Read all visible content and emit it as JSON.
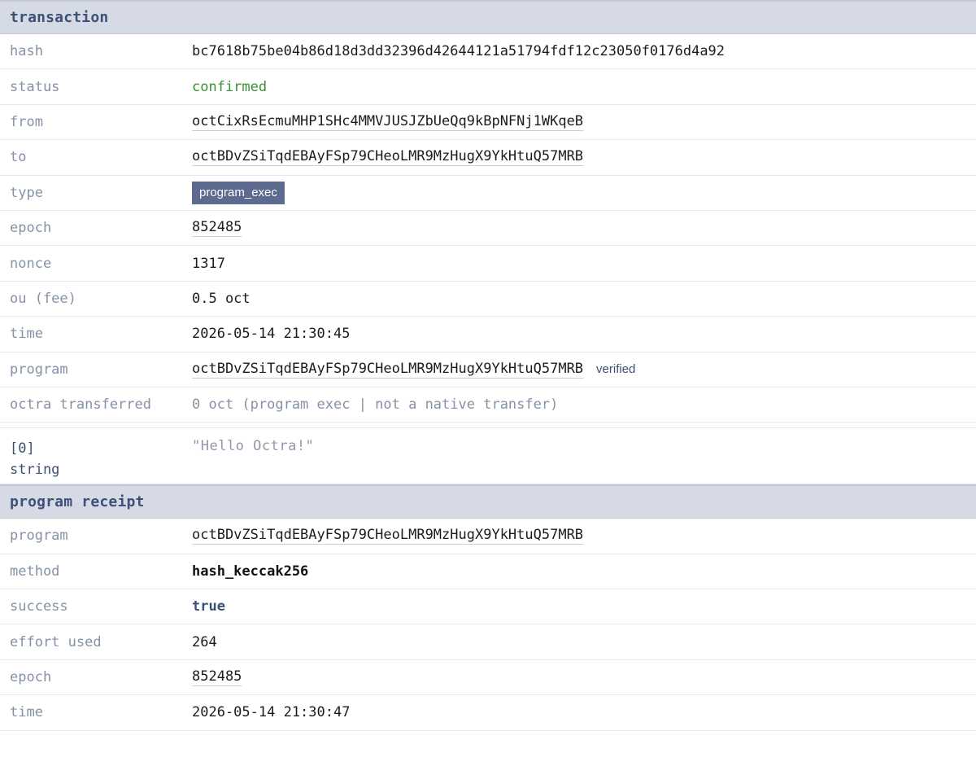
{
  "transaction": {
    "header": "transaction",
    "hash": {
      "label": "hash",
      "value": "bc7618b75be04b86d18d3dd32396d42644121a51794fdf12c23050f0176d4a92"
    },
    "status": {
      "label": "status",
      "value": "confirmed"
    },
    "from": {
      "label": "from",
      "value": "octCixRsEcmuMHP1SHc4MMVJUSJZbUeQq9kBpNFNj1WKqeB"
    },
    "to": {
      "label": "to",
      "value": "octBDvZSiTqdEBAyFSp79CHeoLMR9MzHugX9YkHtuQ57MRB"
    },
    "type": {
      "label": "type",
      "value": "program_exec"
    },
    "epoch": {
      "label": "epoch",
      "value": "852485"
    },
    "nonce": {
      "label": "nonce",
      "value": "1317"
    },
    "fee": {
      "label": "ou (fee)",
      "value": "0.5 oct"
    },
    "time": {
      "label": "time",
      "value": "2026-05-14 21:30:45"
    },
    "program": {
      "label": "program",
      "value": "octBDvZSiTqdEBAyFSp79CHeoLMR9MzHugX9YkHtuQ57MRB",
      "badge": "verified"
    },
    "transferred": {
      "label": "octra transferred",
      "value": "0 oct (program exec | not a native transfer)"
    },
    "arg0": {
      "index": "[0]",
      "type": "string",
      "value": "\"Hello Octra!\""
    }
  },
  "receipt": {
    "header": "program receipt",
    "program": {
      "label": "program",
      "value": "octBDvZSiTqdEBAyFSp79CHeoLMR9MzHugX9YkHtuQ57MRB"
    },
    "method": {
      "label": "method",
      "value": "hash_keccak256"
    },
    "success": {
      "label": "success",
      "value": "true"
    },
    "effort": {
      "label": "effort used",
      "value": "264"
    },
    "epoch": {
      "label": "epoch",
      "value": "852485"
    },
    "time": {
      "label": "time",
      "value": "2026-05-14 21:30:47"
    }
  },
  "colors": {
    "header_bg": "#d5dae5",
    "header_text": "#3d5078",
    "label": "#8592a6",
    "confirmed": "#3a8f3a",
    "badge_bg": "#5b6a8e"
  }
}
